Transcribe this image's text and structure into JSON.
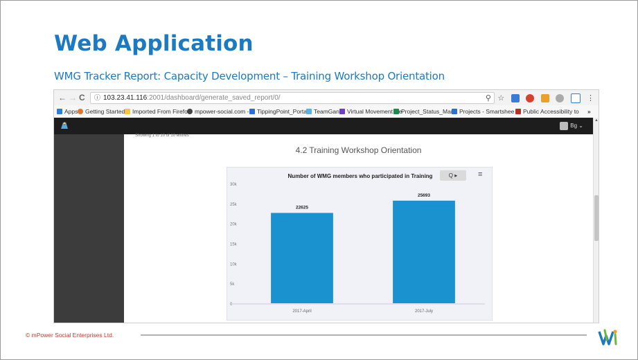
{
  "slide": {
    "title": "Web Application",
    "subtitle": "WMG Tracker Report: Capacity Development – Training Workshop Orientation",
    "footer": "© mPower Social Enterprises Ltd."
  },
  "browser": {
    "nav": {
      "back": "←",
      "forward": "→",
      "reload": "C"
    },
    "address": {
      "lock": "ⓘ",
      "host": "103.23.41.116",
      "path": ":2001/dashboard/generate_saved_report/0/"
    },
    "toolbar_icons": [
      "zoom-icon",
      "star-icon",
      "extension-icon",
      "menu-icon"
    ],
    "bookmarks": [
      {
        "label": "Apps",
        "color": "#2d7fd6"
      },
      {
        "label": "Getting Started",
        "color": "#e8742b"
      },
      {
        "label": "Imported From Firefo",
        "color": "#f6c744"
      },
      {
        "label": "mpower-social.com -",
        "color": "#444444"
      },
      {
        "label": "TippingPoint_Portal",
        "color": "#2b6fd6"
      },
      {
        "label": "TeamGantt",
        "color": "#5bb0e6"
      },
      {
        "label": "Virtual Movement Re",
        "color": "#6f3fbf"
      },
      {
        "label": "Project_Status_Mana",
        "color": "#1f8a4c"
      },
      {
        "label": "Projects - Smartshee",
        "color": "#2e6fcf"
      },
      {
        "label": "Public Accessibility to",
        "color": "#b0341f"
      }
    ],
    "bookmarks_overflow": "»"
  },
  "app": {
    "user_label": "Bg",
    "showing_text": "Showing 1 to 10 of 10 entries",
    "report_title": "4.2 Training Workshop Orientation",
    "zoom_label": "Q ▸"
  },
  "chart_data": {
    "type": "bar",
    "title": "Number of WMG members who participated in Training",
    "categories": [
      "2017-April",
      "2017-July"
    ],
    "values": [
      22625,
      25693
    ],
    "ylim": [
      0,
      30000
    ],
    "yticks": [
      "0",
      "5k",
      "10k",
      "15k",
      "20k",
      "25k",
      "30k"
    ],
    "bar_color": "#1a92d0",
    "grid": false
  }
}
